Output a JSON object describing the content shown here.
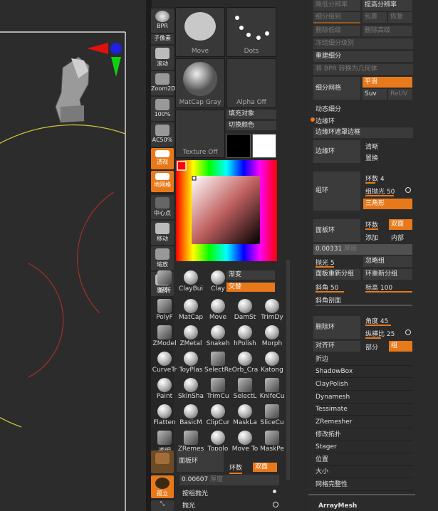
{
  "gallery": {
    "move_label": "Move",
    "dots_label": "Dots",
    "matcap_label": "MatCap Gray",
    "alpha_label": "Alpha Off",
    "texture_label": "Texture Off",
    "fill_object": "填充对象",
    "switch_color": "切换颜色"
  },
  "vtools": [
    "BPR",
    "子像素",
    "滚动",
    "Zoom2D",
    "100%",
    "AC50%",
    "透视",
    "地网格",
    "中心点",
    "移动",
    "缩放",
    "旋转"
  ],
  "left_brushes": {
    "row1": [
      "ClayBui",
      "Clay"
    ],
    "gradient": "渐变",
    "alternate": "交替",
    "row2": [
      "MatCap",
      "Move",
      "DamSt",
      "TrimDy"
    ],
    "row3": [
      "ZModel",
      "ZMetal",
      "Snakeh",
      "hPolish",
      "Morph"
    ],
    "row4": [
      "CurveTr",
      "ToyPlas",
      "SelectRe",
      "Orb_Cra",
      "Katong"
    ],
    "row5": [
      "Paint",
      "SkinSha",
      "TrimCu",
      "SelectL",
      "KnifeCu"
    ],
    "row6": [
      "Flatten",
      "BasicM",
      "ClipCur",
      "MaskLa",
      "SliceCu"
    ],
    "row7": [
      "透明",
      "ZRemes",
      "Topolo",
      "Move To",
      "MaskPe"
    ],
    "solo": "孤立",
    "polyf": "PolyF",
    "face_ring": "面板环",
    "ring_count": "环数",
    "double_face": "双面",
    "thickness_value": "0.00607",
    "thickness_label": "厚度",
    "group_polish": "按组抛光",
    "polish": "抛光"
  },
  "right": {
    "top": [
      "降低分辨率",
      "提高分辨率",
      "细分级别",
      "包裹",
      "恢复",
      "删除低级",
      "删除高级",
      "冻结细分级别",
      "重建细分",
      "将 BPR 转换为几何体"
    ],
    "subdiv_mesh": "细分网格",
    "smooth": "平滑",
    "suv": "Suv",
    "reuv": "ReUV",
    "dynamic_subdiv": "动态细分",
    "edge_loop": "边缘环",
    "edge_loop_mask": "边缘环遮罩边框",
    "edge_loop_btn": "边缘环",
    "clear": "清晰",
    "replace": "置换",
    "group_loop": "组环",
    "loops": "环数",
    "loops_val": "4",
    "group_polish": "组抛光",
    "group_polish_val": "50",
    "triangle": "三角形",
    "panel_loop": "面板环",
    "panel_loops": "环数",
    "double": "双面",
    "add": "添加",
    "inner": "内部",
    "thickness_val": "0.00331",
    "thickness": "厚度",
    "polish": "抛光",
    "polish_val": "5",
    "ignore_group": "忽略组",
    "panel_regroup": "面板重新分组",
    "loop_regroup": "环重新分组",
    "bevel": "斜角",
    "bevel_val": "50",
    "elevation": "标高",
    "elevation_val": "100",
    "bevel_profile": "斜角剖面",
    "delete_loop": "删除环",
    "angle": "角度",
    "angle_val": "45",
    "aspect": "纵横比",
    "aspect_val": "25",
    "align_loop": "对齐环",
    "partial": "部分",
    "group": "组",
    "menu": [
      "折边",
      "ShadowBox",
      "ClayPolish",
      "Dynamesh",
      "Tessimate",
      "ZRemesher",
      "修改拓扑",
      "Stager",
      "位置",
      "大小",
      "网格完整性"
    ],
    "arraymesh": "ArrayMesh"
  },
  "colors": {
    "accent": "#e8791b",
    "panel": "#2b2b2b",
    "button": "#3a3a3a"
  }
}
